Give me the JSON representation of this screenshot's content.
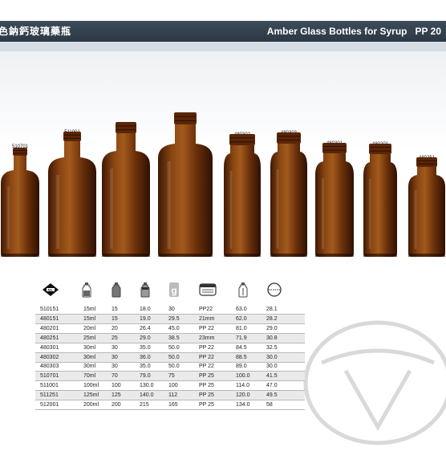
{
  "header": {
    "title_cn": "色鈉鈣玻璃藥瓶",
    "title_en": "Amber Glass Bottles for Syrup",
    "series_code": "PP 20"
  },
  "bottles": [
    {
      "code": "510701"
    },
    {
      "code": "511001"
    },
    {
      "code": "511251"
    },
    {
      "code": "512001"
    },
    {
      "code": "480302"
    },
    {
      "code": "480303"
    },
    {
      "code": "480301"
    },
    {
      "code": "480201"
    },
    {
      "code": "480251"
    }
  ],
  "legend_icons": [
    "item-code-icon",
    "bottle-volume-icon",
    "full-volume-icon",
    "bottle-capacity-icon",
    "weight-icon",
    "neck-finish-icon",
    "height-icon",
    "diameter-icon"
  ],
  "colors": {
    "header_bg": "#2f3b47",
    "amber": "#7a3a0c",
    "row_alt": "#eaeaea"
  },
  "table": {
    "rows": [
      [
        "510151",
        "15ml",
        "15",
        "18.0",
        "30",
        "PP22",
        "63.0",
        "28.1"
      ],
      [
        "480151",
        "15ml",
        "15",
        "19.0",
        "29.5",
        "21mm",
        "62.0",
        "28.2"
      ],
      [
        "480201",
        "20ml",
        "20",
        "26.4",
        "45.0",
        "PP 22",
        "81.0",
        "29.0"
      ],
      [
        "480251",
        "25ml",
        "25",
        "29.0",
        "38.5",
        "23mm",
        "71.9",
        "30.8"
      ],
      [
        "480301",
        "30ml",
        "30",
        "35.0",
        "50.0",
        "PP 22",
        "84.5",
        "32.5"
      ],
      [
        "480302",
        "30ml",
        "30",
        "36.0",
        "50.0",
        "PP 22",
        "88.5",
        "30.0"
      ],
      [
        "480303",
        "30ml",
        "30",
        "35.0",
        "50.0",
        "PP 22",
        "89.0",
        "30.0"
      ],
      [
        "510701",
        "70ml",
        "70",
        "79.0",
        "75",
        "PP 25",
        "100.0",
        "41.5"
      ],
      [
        "511001",
        "100ml",
        "100",
        "130.0",
        "100",
        "PP 25",
        "114.0",
        "47.0"
      ],
      [
        "511251",
        "125ml",
        "125",
        "140.0",
        "112",
        "PP 25",
        "120.0",
        "49.5"
      ],
      [
        "512001",
        "200ml",
        "200",
        "215",
        "165",
        "PP 25",
        "134.0",
        "58"
      ]
    ]
  }
}
